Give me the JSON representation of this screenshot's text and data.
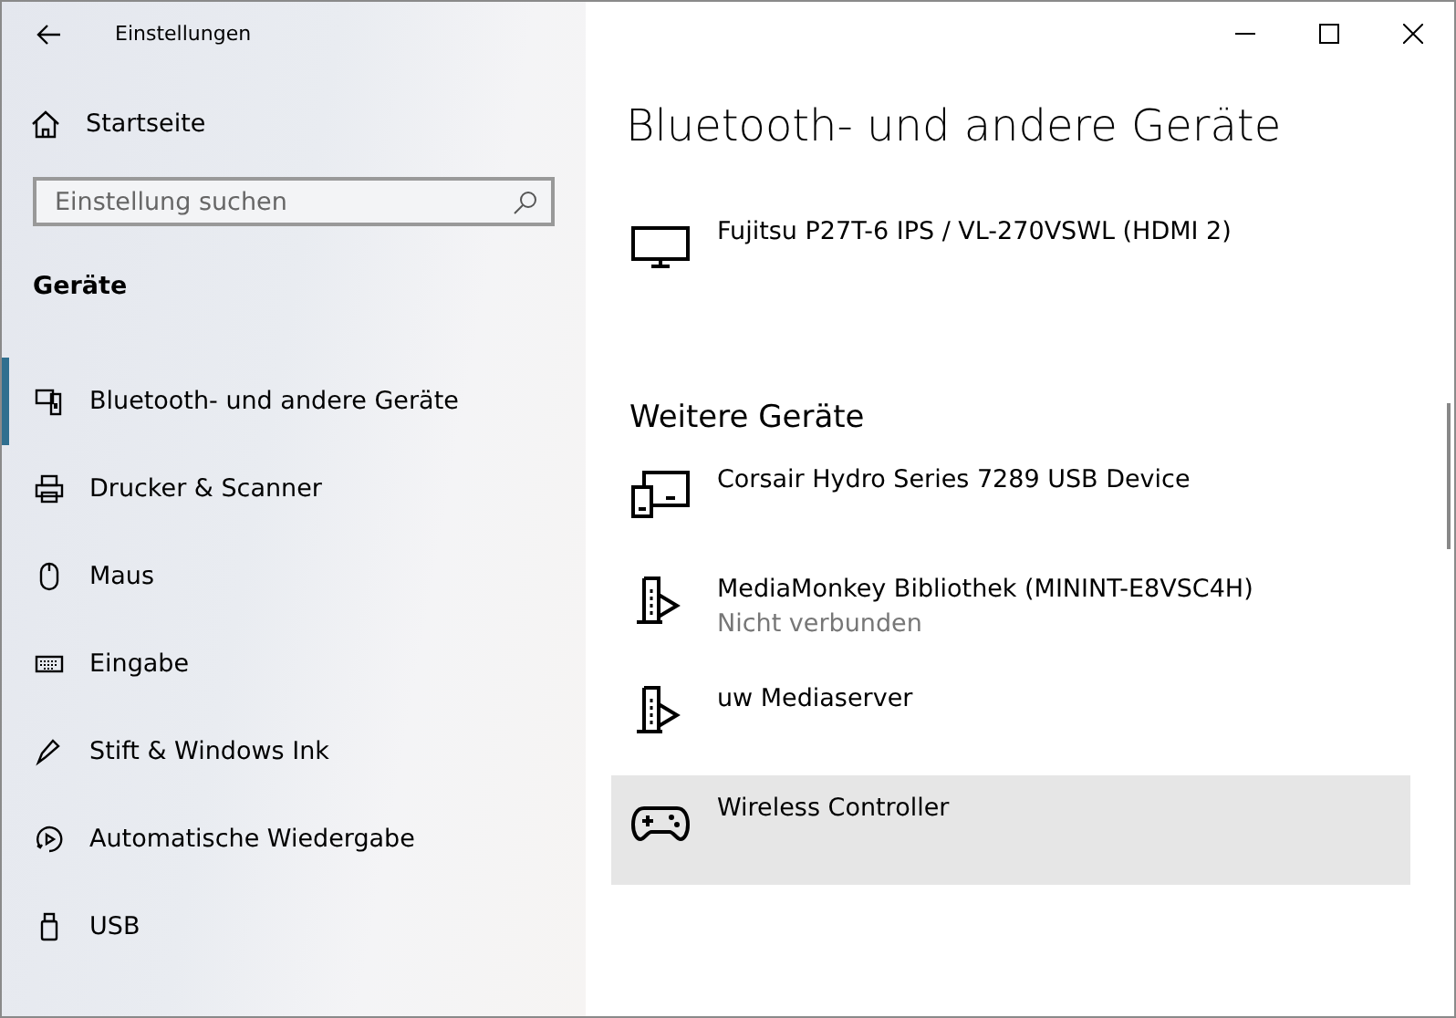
{
  "window": {
    "title": "Einstellungen",
    "controls": [
      {
        "kind": "minimize"
      },
      {
        "kind": "maximize"
      },
      {
        "kind": "close"
      }
    ]
  },
  "sidebar": {
    "home": "Startseite",
    "search": {
      "placeholder": "Einstellung suchen"
    },
    "section": "Geräte",
    "items": [
      {
        "label": "Bluetooth- und andere Geräte",
        "kind": "bluetooth",
        "selected": true
      },
      {
        "label": "Drucker & Scanner",
        "kind": "printer",
        "selected": false
      },
      {
        "label": "Maus",
        "kind": "mouse",
        "selected": false
      },
      {
        "label": "Eingabe",
        "kind": "keyboard",
        "selected": false
      },
      {
        "label": "Stift & Windows Ink",
        "kind": "pen",
        "selected": false
      },
      {
        "label": "Automatische Wiedergabe",
        "kind": "autoplay",
        "selected": false
      },
      {
        "label": "USB",
        "kind": "usb",
        "selected": false
      }
    ]
  },
  "main": {
    "title": "Bluetooth- und andere Geräte",
    "sections": [
      {
        "devices": [
          {
            "name": "Fujitsu P27T-6 IPS / VL-270VSWL (HDMI 2)",
            "kind": "monitor",
            "selected": false
          }
        ]
      },
      {
        "heading": "Weitere Geräte",
        "devices": [
          {
            "name": "Corsair Hydro Series 7289 USB Device",
            "kind": "devices",
            "selected": false
          },
          {
            "name": "MediaMonkey Bibliothek (MININT-E8VSC4H)",
            "status": "Nicht verbunden",
            "kind": "media",
            "selected": false
          },
          {
            "name": "uw Mediaserver",
            "kind": "media",
            "selected": false
          },
          {
            "name": "Wireless Controller",
            "kind": "gamepad",
            "selected": true
          }
        ]
      }
    ]
  }
}
